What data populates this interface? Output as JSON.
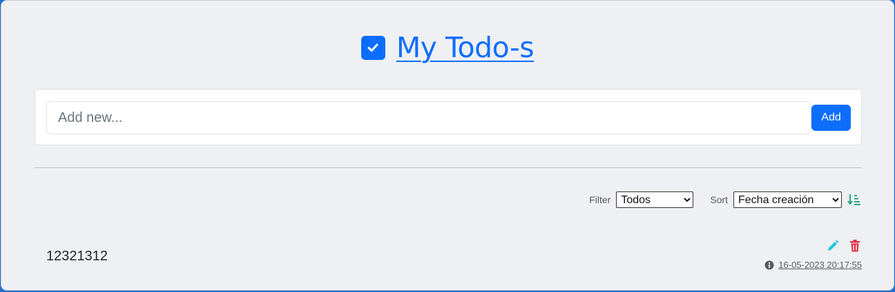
{
  "header": {
    "title": "My Todo-s",
    "icon": "check-square-icon",
    "accent_color": "#0d6efd"
  },
  "add_form": {
    "placeholder": "Add new...",
    "value": "",
    "add_label": "Add"
  },
  "controls": {
    "filter_label": "Filter",
    "filter_value": "Todos",
    "sort_label": "Sort",
    "sort_value": "Fecha creación",
    "sort_icon": "sort-ascending-icon"
  },
  "todos": [
    {
      "text": "12321312",
      "date": " 16-05-2023 20:17:55",
      "edit_icon": "pencil-icon",
      "delete_icon": "trash-icon",
      "info_icon": "info-circle-icon"
    }
  ]
}
